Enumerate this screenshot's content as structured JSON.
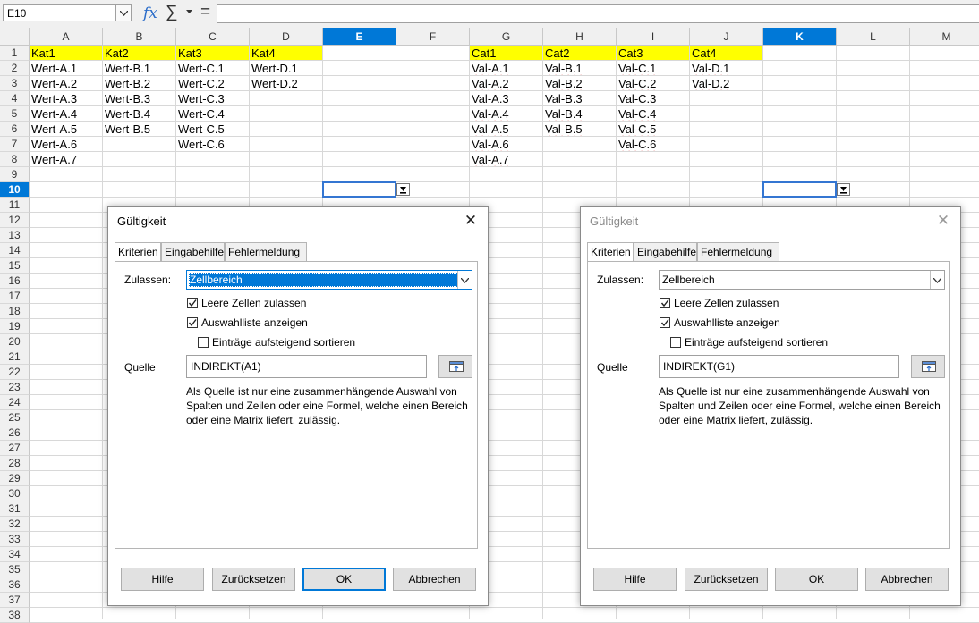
{
  "formula_bar": {
    "name_box": "E10",
    "fx_symbol": "𝑓x",
    "sum_symbol": "∑",
    "eq_symbol": "="
  },
  "columns": [
    "A",
    "B",
    "C",
    "D",
    "E",
    "F",
    "G",
    "H",
    "I",
    "J",
    "K",
    "L",
    "M"
  ],
  "selected_columns": [
    "E",
    "K"
  ],
  "rows": [
    "1",
    "2",
    "3",
    "4",
    "5",
    "6",
    "7",
    "8",
    "9",
    "10",
    "11",
    "12",
    "13",
    "14",
    "15",
    "16",
    "17",
    "18",
    "19",
    "20",
    "21",
    "22",
    "23",
    "24",
    "25",
    "26",
    "27",
    "28",
    "29",
    "30",
    "31",
    "32",
    "33",
    "34",
    "35",
    "36",
    "37",
    "38"
  ],
  "selected_row": "10",
  "cells": {
    "A1": "Kat1",
    "B1": "Kat2",
    "C1": "Kat3",
    "D1": "Kat4",
    "A2": "Wert-A.1",
    "B2": "Wert-B.1",
    "C2": "Wert-C.1",
    "D2": "Wert-D.1",
    "A3": "Wert-A.2",
    "B3": "Wert-B.2",
    "C3": "Wert-C.2",
    "D3": "Wert-D.2",
    "A4": "Wert-A.3",
    "B4": "Wert-B.3",
    "C4": "Wert-C.3",
    "A5": "Wert-A.4",
    "B5": "Wert-B.4",
    "C5": "Wert-C.4",
    "A6": "Wert-A.5",
    "B6": "Wert-B.5",
    "C6": "Wert-C.5",
    "A7": "Wert-A.6",
    "C7": "Wert-C.6",
    "A8": "Wert-A.7",
    "G1": "Cat1",
    "H1": "Cat2",
    "I1": "Cat3",
    "J1": "Cat4",
    "G2": "Val-A.1",
    "H2": "Val-B.1",
    "I2": "Val-C.1",
    "J2": "Val-D.1",
    "G3": "Val-A.2",
    "H3": "Val-B.2",
    "I3": "Val-C.2",
    "J3": "Val-D.2",
    "G4": "Val-A.3",
    "H4": "Val-B.3",
    "I4": "Val-C.3",
    "G5": "Val-A.4",
    "H5": "Val-B.4",
    "I5": "Val-C.4",
    "G6": "Val-A.5",
    "H6": "Val-B.5",
    "I6": "Val-C.5",
    "G7": "Val-A.6",
    "I7": "Val-C.6",
    "G8": "Val-A.7"
  },
  "header_fill": "#ffff00",
  "accent": "#0078d7",
  "dialog_left": {
    "title": "Gültigkeit",
    "tabs": [
      "Kriterien",
      "Eingabehilfe",
      "Fehlermeldung"
    ],
    "allow_label": "Zulassen:",
    "allow_value": "Zellbereich",
    "allow_empty": "Leere Zellen zulassen",
    "show_list": "Auswahlliste anzeigen",
    "sort_asc": "Einträge aufsteigend sortieren",
    "source_label": "Quelle",
    "source_value": "INDIREKT(A1)",
    "help_text": "Als Quelle ist nur eine zusammenhängende Auswahl von Spalten und Zeilen oder eine Formel, welche einen Bereich oder eine Matrix liefert, zulässig.",
    "btn_help": "Hilfe",
    "btn_reset": "Zurücksetzen",
    "btn_ok": "OK",
    "btn_cancel": "Abbrechen"
  },
  "dialog_right": {
    "title": "Gültigkeit",
    "tabs": [
      "Kriterien",
      "Eingabehilfe",
      "Fehlermeldung"
    ],
    "allow_label": "Zulassen:",
    "allow_value": "Zellbereich",
    "allow_empty": "Leere Zellen zulassen",
    "show_list": "Auswahlliste anzeigen",
    "sort_asc": "Einträge aufsteigend sortieren",
    "source_label": "Quelle",
    "source_value": "INDIREKT(G1)",
    "help_text": "Als Quelle ist nur eine zusammenhängende Auswahl von Spalten und Zeilen oder eine Formel, welche einen Bereich oder eine Matrix liefert, zulässig.",
    "btn_help": "Hilfe",
    "btn_reset": "Zurücksetzen",
    "btn_ok": "OK",
    "btn_cancel": "Abbrechen"
  }
}
